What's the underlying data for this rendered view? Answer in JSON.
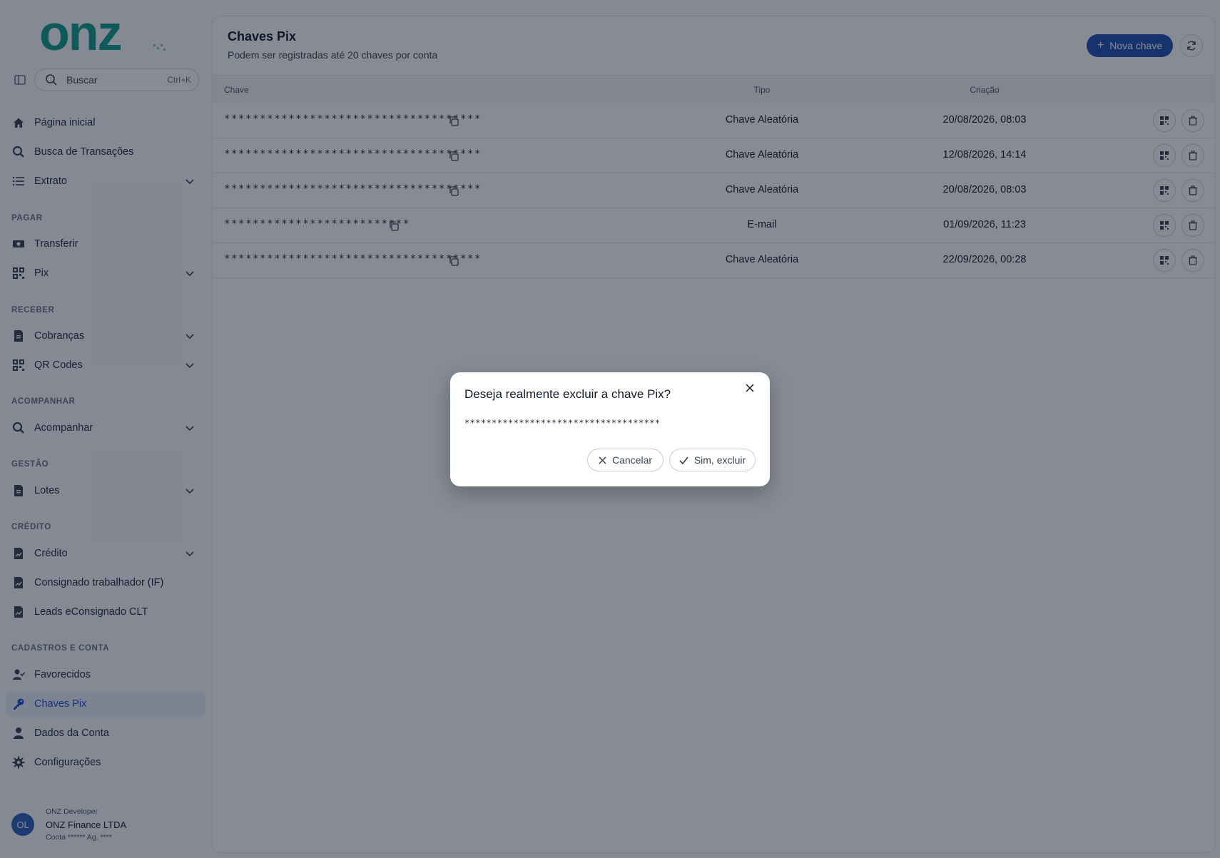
{
  "app": {
    "logo_text": "onz",
    "brand_color": "#0d9b8a",
    "accent_color": "#1d4fb0"
  },
  "search": {
    "label": "Buscar",
    "shortcut": "Ctrl+K"
  },
  "nav": {
    "home": "Página inicial",
    "transactions": "Busca de Transações",
    "statement": "Extrato",
    "section_pay": "PAGAR",
    "transfer": "Transferir",
    "pix": "Pix",
    "section_receive": "RECEBER",
    "charges": "Cobranças",
    "qrcodes": "QR Codes",
    "section_track": "ACOMPANHAR",
    "track": "Acompanhar",
    "section_management": "GESTÃO",
    "batches": "Lotes",
    "section_credit": "CRÉDITO",
    "credit": "Crédito",
    "payroll": "Consignado trabalhador (IF)",
    "leads": "Leads eConsignado CLT",
    "section_account": "CADASTROS E CONTA",
    "favorites": "Favorecidos",
    "pix_keys": "Chaves Pix",
    "account_data": "Dados da Conta",
    "settings": "Configurações"
  },
  "user": {
    "initials": "OL",
    "role": "ONZ Developer",
    "company": "ONZ Finance LTDA",
    "account": "Conta ****** Ag. ****"
  },
  "page": {
    "title": "Chaves Pix",
    "subtitle": "Podem ser registradas até 20 chaves por conta",
    "new_key": "Nova chave"
  },
  "table": {
    "columns": {
      "key": "Chave",
      "type": "Tipo",
      "created": "Criação"
    },
    "rows": [
      {
        "key": "************************************",
        "type": "Chave Aleatória",
        "created": "20/08/2026, 08:03"
      },
      {
        "key": "************************************",
        "type": "Chave Aleatória",
        "created": "12/08/2026, 14:14"
      },
      {
        "key": "************************************",
        "type": "Chave Aleatória",
        "created": "20/08/2026, 08:03"
      },
      {
        "key": "**************************",
        "type": "E-mail",
        "created": "01/09/2026, 11:23"
      },
      {
        "key": "************************************",
        "type": "Chave Aleatória",
        "created": "22/09/2026, 00:28"
      }
    ]
  },
  "modal": {
    "title": "Deseja realmente excluir a chave Pix?",
    "key": "************************************",
    "cancel": "Cancelar",
    "confirm": "Sim, excluir"
  }
}
